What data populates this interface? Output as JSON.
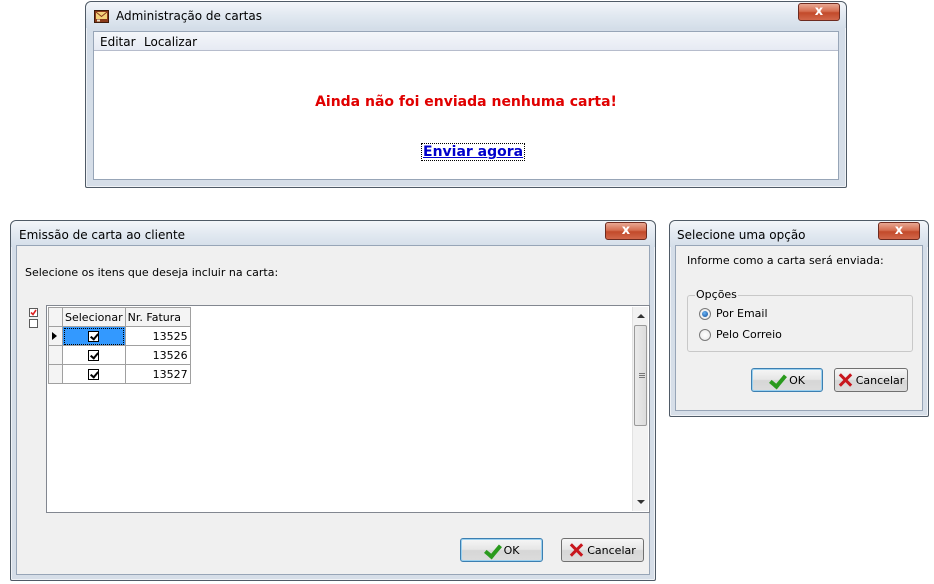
{
  "admin_window": {
    "title": "Administração de cartas",
    "close_label": "x",
    "menu": {
      "edit": "Editar",
      "find": "Localizar"
    },
    "message": "Ainda não foi enviada nenhuma carta!",
    "send_now": "Enviar agora"
  },
  "emission_window": {
    "title": "Emissão de carta ao cliente",
    "close_label": "x",
    "instructions": "Selecione os itens que deseja incluir na carta:",
    "grid": {
      "columns": [
        "Selecionar",
        "Nr. Fatura"
      ],
      "rows": [
        {
          "selected": true,
          "invoice": "13525"
        },
        {
          "selected": true,
          "invoice": "13526"
        },
        {
          "selected": true,
          "invoice": "13527"
        }
      ]
    },
    "ok_label": "OK",
    "cancel_label": "Cancelar"
  },
  "option_window": {
    "title": "Selecione uma opção",
    "close_label": "x",
    "instructions": "Informe como a carta será enviada:",
    "group_label": "Opções",
    "options": [
      {
        "label": "Por Email",
        "checked": true
      },
      {
        "label": "Pelo Correio",
        "checked": false
      }
    ],
    "ok_label": "OK",
    "cancel_label": "Cancelar"
  },
  "colors": {
    "alert_text": "#e00000",
    "link_text": "#0000cc",
    "selection": "#3399ff",
    "ok_check": "#2a9a1d",
    "cancel_x": "#c8161d"
  }
}
